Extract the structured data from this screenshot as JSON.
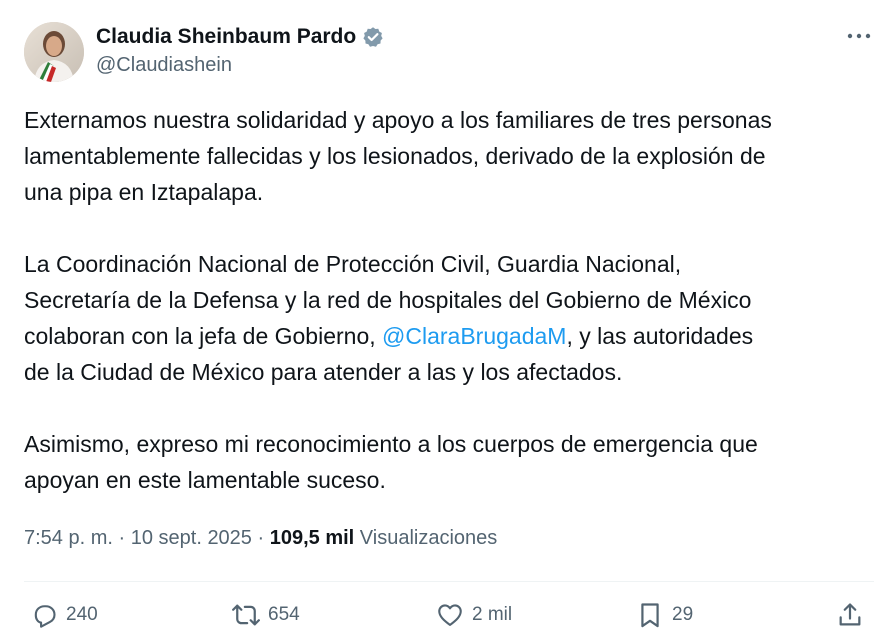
{
  "author": {
    "display_name": "Claudia Sheinbaum Pardo",
    "handle": "@Claudiashein",
    "verified_icon": "verified-badge-icon"
  },
  "tweet": {
    "paragraphs": [
      {
        "lines": [
          "Externamos nuestra solidaridad y apoyo a los familiares de tres personas",
          "lamentablemente fallecidas y los lesionados, derivado de la explosión de",
          "una pipa en Iztapalapa."
        ]
      },
      {
        "lines": [
          "La Coordinación Nacional de Protección Civil, Guardia Nacional,",
          "Secretaría de la Defensa y la red de hospitales del Gobierno de México"
        ],
        "mention_line": {
          "before": "colaboran con la jefa de Gobierno, ",
          "mention": "@ClaraBrugadaM",
          "after": ", y las autoridades"
        },
        "last_line": "de la Ciudad de México para atender a las y los afectados."
      },
      {
        "lines": [
          "Asimismo, expreso mi reconocimiento a los cuerpos de emergencia que",
          "apoyan en este lamentable suceso."
        ]
      }
    ]
  },
  "meta": {
    "time": "7:54 p. m.",
    "separator": " · ",
    "date": "10 sept. 2025",
    "views_count": "109,5 mil",
    "views_label": "Visualizaciones"
  },
  "actions": {
    "replies": "240",
    "reposts": "654",
    "likes": "2 mil",
    "bookmarks": "29"
  },
  "colors": {
    "text": "#0f1419",
    "secondary": "#536471",
    "link": "#1d9bf0",
    "verified": "#829aab",
    "divider": "#eff3f4"
  }
}
